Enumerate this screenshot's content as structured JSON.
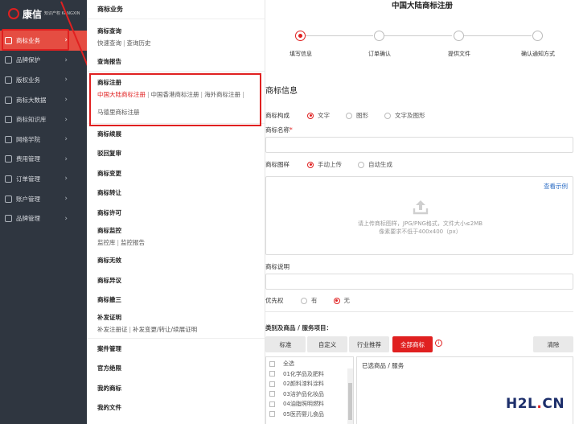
{
  "brand": {
    "name": "康信",
    "subtitle": "知识产权 KANGXIN"
  },
  "sidebar": {
    "items": [
      {
        "label": "商标业务",
        "icon": "trademark-icon",
        "active": true
      },
      {
        "label": "品牌保护",
        "icon": "shield-icon"
      },
      {
        "label": "版权业务",
        "icon": "copyright-icon"
      },
      {
        "label": "商标大数据",
        "icon": "data-icon"
      },
      {
        "label": "商标知识库",
        "icon": "book-icon"
      },
      {
        "label": "网络学院",
        "icon": "school-icon"
      },
      {
        "label": "费用管理",
        "icon": "fee-icon"
      },
      {
        "label": "订单管理",
        "icon": "order-icon"
      },
      {
        "label": "账户管理",
        "icon": "account-icon"
      },
      {
        "label": "品牌管理",
        "icon": "brand-icon"
      }
    ]
  },
  "submenu": {
    "header": "商标业务",
    "query": {
      "title": "商标查询",
      "links": [
        "快速查询",
        "查询历史"
      ]
    },
    "report": "查询报告",
    "register": {
      "title": "商标注册",
      "links": [
        "中国大陆商标注册",
        "中国香港商标注册",
        "海外商标注册",
        "马德里商标注册"
      ]
    },
    "items_a": [
      "商标续展",
      "驳回复审",
      "商标变更",
      "商标转让",
      "商标许可"
    ],
    "monitor": {
      "title": "商标监控",
      "links": [
        "监控库",
        "监控报告"
      ]
    },
    "items_b": [
      "商标无效",
      "商标异议",
      "商标撤三"
    ],
    "cert": {
      "title": "补发证明",
      "links": [
        "补发注册证",
        "补发变更/转让/续展证明"
      ]
    },
    "items_c": [
      "案件管理",
      "官方绝限",
      "我的商标",
      "我的文件"
    ]
  },
  "main": {
    "title": "中国大陆商标注册",
    "steps": [
      "填写信息",
      "订单确认",
      "提供文件",
      "确认通知方式"
    ],
    "section_title": "商标信息",
    "composition": {
      "label": "商标构成",
      "options": [
        "文字",
        "图形",
        "文字及图形"
      ]
    },
    "name_label": "商标名称",
    "required_mark": "*",
    "pattern": {
      "label": "商标图样",
      "options": [
        "手动上传",
        "自动生成"
      ]
    },
    "upload": {
      "view_example": "查看示例",
      "hint1": "请上传商标图样，JPG/PNG格式，文件大小≤2MB",
      "hint2": "像素要求不低于400x400（px）"
    },
    "description_label": "商标说明",
    "priority": {
      "label": "优先权",
      "options": [
        "有",
        "无"
      ]
    },
    "goods_label": "类别及商品 / 服务项目：",
    "goods_tabs": [
      "标准",
      "自定义",
      "行业推荐",
      "全部商标"
    ],
    "info_icon_text": "i",
    "clear_label": "清除",
    "class_list": [
      "全选",
      "01化学品及肥料",
      "02颜料漆料涂料",
      "03洁护品化妆品",
      "04油脂照明燃料",
      "05医药婴儿食品"
    ],
    "selected_label": "已选商品 / 服务"
  },
  "watermark": {
    "text1": "H2L",
    "dot": ".",
    "text2": "CN"
  },
  "colors": {
    "accent": "#e02020",
    "sidebar_bg": "#2f3640",
    "link_blue": "#2f6fc6"
  }
}
